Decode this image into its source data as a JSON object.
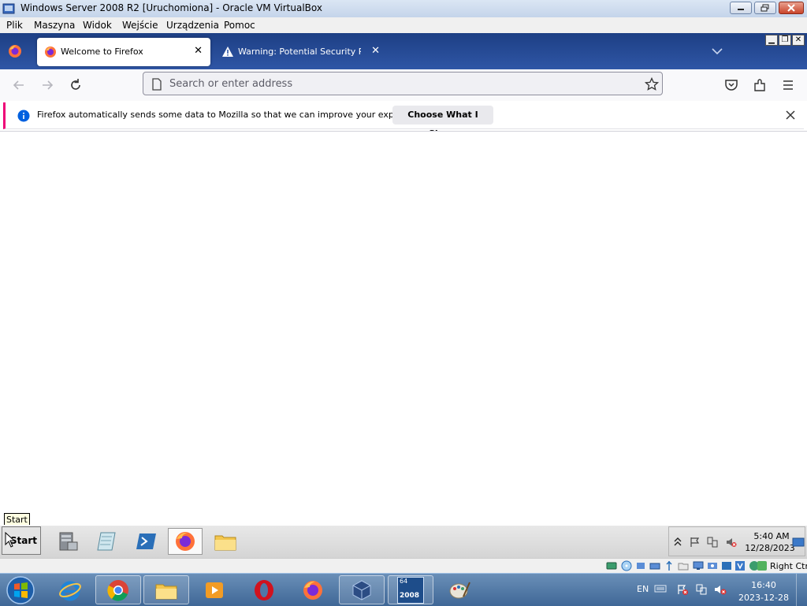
{
  "vbox": {
    "window_title": "Windows Server 2008 R2 [Uruchomiona] - Oracle VM VirtualBox",
    "menu": [
      "Plik",
      "Maszyna",
      "Widok",
      "Wejście",
      "Urządzenia",
      "Pomoc"
    ],
    "host_key": "Right Ctrl"
  },
  "firefox": {
    "tabs": [
      {
        "label": "Welcome to Firefox",
        "active": true,
        "icon": "firefox-icon"
      },
      {
        "label": "Warning: Potential Security Risk Ahead",
        "active": false,
        "icon": "warning-icon"
      }
    ],
    "url_placeholder": "Search or enter address",
    "notice_text": "Firefox automatically sends some data to Mozilla so that we can improve your experience.",
    "notice_button": "Choose What I Share"
  },
  "guest": {
    "tooltip": "Start",
    "start_label": "Start",
    "clock_time": "5:40 AM",
    "clock_date": "12/28/2023",
    "taskbar_apps": [
      "server-manager-icon",
      "notepad-icon",
      "powershell-icon",
      "firefox-icon",
      "explorer-icon"
    ]
  },
  "host": {
    "lang": "EN",
    "time": "16:40",
    "date": "2023-12-28",
    "badge_64": "64",
    "badge_2008": "2008",
    "taskbar_apps": [
      "ie-icon",
      "chrome-icon",
      "explorer-icon",
      "media-player-icon",
      "opera-icon",
      "firefox-icon",
      "virtualbox-icon",
      "server-2008-icon",
      "paint-icon"
    ]
  },
  "colors": {
    "ff_tabstrip": "#1d3f84",
    "notice_accent": "#ee0077",
    "host_taskbar": "#4f77a6"
  }
}
